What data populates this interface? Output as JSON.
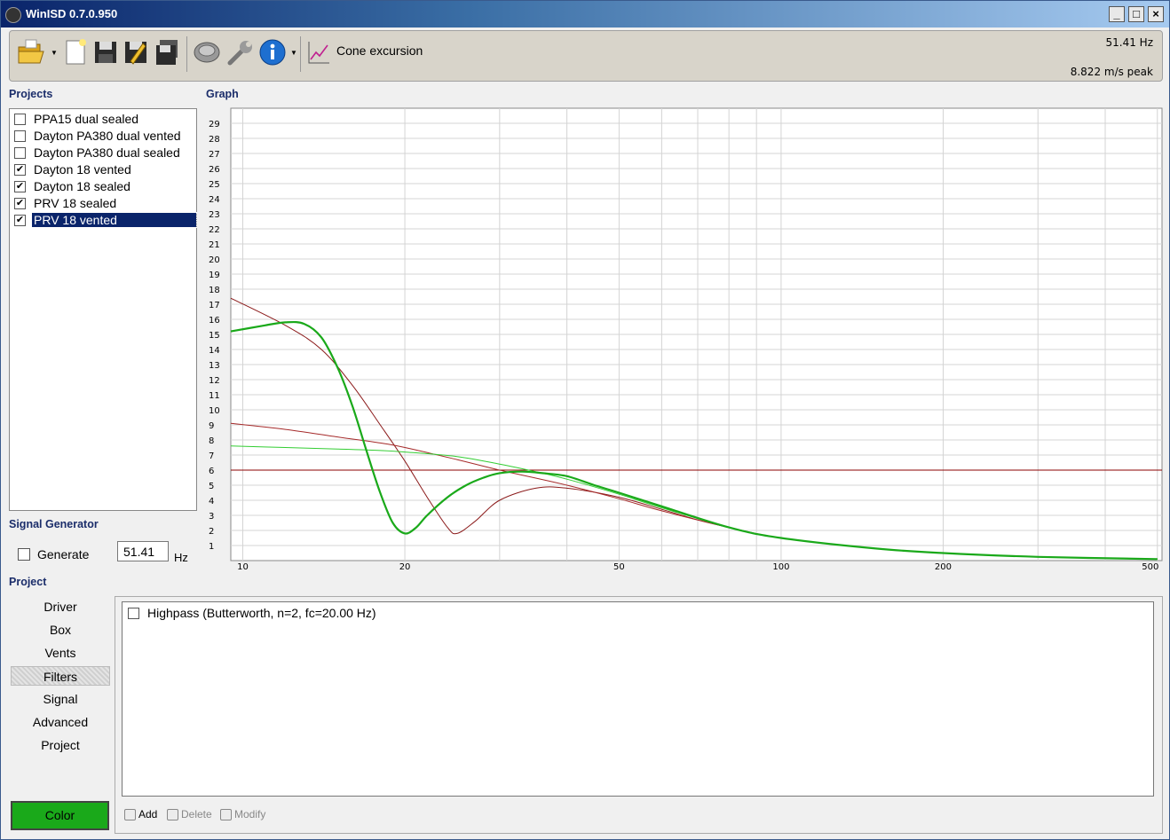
{
  "window": {
    "title": "WinISD 0.7.0.950"
  },
  "toolbar": {
    "cone_label": "Cone excursion",
    "freq_readout": "51.41 Hz",
    "excursion_readout": "8.822 m/s peak",
    "icons": [
      "open-folder-icon",
      "new-document-icon",
      "save-icon",
      "save-as-icon",
      "save-all-icon",
      "driver-icon",
      "wrench-icon",
      "info-icon",
      "graph-icon"
    ]
  },
  "projects": {
    "label": "Projects",
    "items": [
      {
        "label": "PPA15 dual sealed",
        "checked": false,
        "selected": false
      },
      {
        "label": "Dayton PA380 dual vented",
        "checked": false,
        "selected": false
      },
      {
        "label": "Dayton PA380 dual sealed",
        "checked": false,
        "selected": false
      },
      {
        "label": "Dayton 18 vented",
        "checked": true,
        "selected": false
      },
      {
        "label": "Dayton 18 sealed",
        "checked": true,
        "selected": false
      },
      {
        "label": "PRV 18 sealed",
        "checked": true,
        "selected": false
      },
      {
        "label": "PRV 18 vented",
        "checked": true,
        "selected": true
      }
    ]
  },
  "signal_generator": {
    "label": "Signal Generator",
    "generate_label": "Generate",
    "frequency": "51.41",
    "unit": "Hz"
  },
  "project_nav": {
    "label": "Project",
    "items": [
      "Driver",
      "Box",
      "Vents",
      "Filters",
      "Signal",
      "Advanced",
      "Project"
    ],
    "active": "Filters",
    "color_button": "Color",
    "color_value": "#1aa91a"
  },
  "filters": {
    "items": [
      {
        "label": "Highpass (Butterworth, n=2, fc=20.00 Hz)",
        "checked": false
      }
    ],
    "actions": {
      "add": "Add",
      "delete": "Delete",
      "modify": "Modify"
    }
  },
  "graph_label": "Graph",
  "chart_data": {
    "type": "line",
    "title": "",
    "xlabel": "",
    "ylabel": "",
    "x_scale": "log",
    "xlim": [
      9.5,
      510
    ],
    "ylim": [
      0,
      30
    ],
    "x_ticks": [
      10,
      20,
      50,
      100,
      200,
      500
    ],
    "y_ticks": [
      1,
      2,
      3,
      4,
      5,
      6,
      7,
      8,
      9,
      10,
      11,
      12,
      13,
      14,
      15,
      16,
      17,
      18,
      19,
      20,
      21,
      22,
      23,
      24,
      25,
      26,
      27,
      28,
      29
    ],
    "grid": true,
    "legend": "none",
    "series": [
      {
        "color": "#8b0000",
        "style": "horizontal-limit",
        "x": [
          9.5,
          510
        ],
        "y": [
          6,
          6
        ]
      },
      {
        "color": "#8b1a1a",
        "x": [
          9.5,
          12,
          14,
          16,
          18,
          20,
          22,
          24,
          25,
          27,
          30,
          35,
          40,
          50,
          60,
          70,
          80,
          100,
          150,
          200,
          300,
          500
        ],
        "y": [
          17.4,
          15.6,
          14.0,
          11.6,
          9.0,
          6.6,
          4.2,
          2.2,
          1.8,
          2.6,
          4.0,
          4.8,
          4.8,
          4.2,
          3.4,
          2.7,
          2.2,
          1.5,
          0.8,
          0.5,
          0.25,
          0.1
        ]
      },
      {
        "color": "#a52a2a",
        "x": [
          9.5,
          12,
          15,
          18,
          20,
          25,
          30,
          40,
          50,
          60,
          80,
          100,
          150,
          200,
          300,
          500
        ],
        "y": [
          9.1,
          8.7,
          8.2,
          7.8,
          7.5,
          6.7,
          6.0,
          5.0,
          4.1,
          3.3,
          2.2,
          1.5,
          0.8,
          0.5,
          0.25,
          0.1
        ]
      },
      {
        "color": "#32cd32",
        "x": [
          9.5,
          12,
          15,
          18,
          20,
          25,
          30,
          35,
          40,
          50,
          60,
          80,
          100,
          150,
          200,
          300,
          500
        ],
        "y": [
          7.6,
          7.5,
          7.4,
          7.3,
          7.2,
          6.9,
          6.4,
          5.9,
          5.4,
          4.4,
          3.5,
          2.2,
          1.5,
          0.8,
          0.5,
          0.25,
          0.1
        ]
      },
      {
        "color": "#1aa91a",
        "x": [
          9.5,
          11,
          12,
          13,
          14,
          15,
          16,
          17,
          18,
          19,
          20,
          21,
          22,
          24,
          26,
          28,
          30,
          33,
          36,
          40,
          45,
          50,
          60,
          80,
          100,
          150,
          200,
          300,
          500
        ],
        "y": [
          15.2,
          15.6,
          15.8,
          15.7,
          14.8,
          12.8,
          10.2,
          7.2,
          4.5,
          2.5,
          1.8,
          2.2,
          3.0,
          4.2,
          5.0,
          5.5,
          5.8,
          5.9,
          5.8,
          5.6,
          5.0,
          4.5,
          3.6,
          2.2,
          1.5,
          0.8,
          0.5,
          0.25,
          0.1
        ]
      }
    ]
  }
}
